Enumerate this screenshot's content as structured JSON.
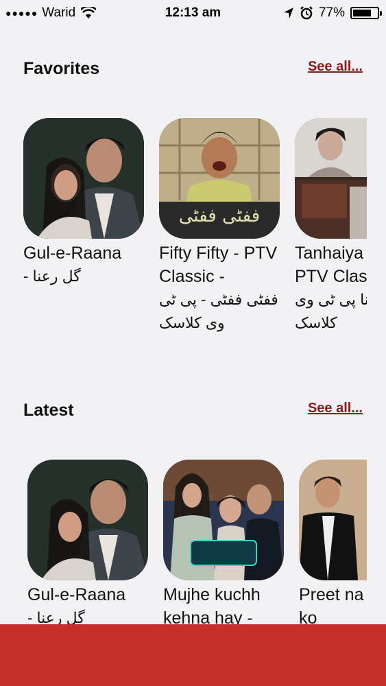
{
  "status_bar": {
    "carrier": "Warid",
    "time": "12:13 am",
    "battery": "77%",
    "battery_level": 0.77
  },
  "favorites": {
    "title": "Favorites",
    "see_all": "See all...",
    "items": [
      {
        "title_en": "Gul-e-Raana",
        "title_ur": "گل رعنا -"
      },
      {
        "title_en": "Fifty Fifty - PTV Classic -",
        "title_ur": "ففٹی ففٹی - پی ٹی وی کلاسک"
      },
      {
        "title_en": "Tanhaiya Old PTV Classic -",
        "title_ur": "پرانا پی ٹی وی کلاسک"
      }
    ],
    "thumb_text": "ففٹی ففٹی"
  },
  "latest": {
    "title": "Latest",
    "see_all": "See all...",
    "items": [
      {
        "title_en": "Gul-e-Raana",
        "title_ur": "گل رعنا -"
      },
      {
        "title_en": "Mujhe kuchh kehna hay -",
        "title_ur": ""
      },
      {
        "title_en": "Preet na kariyo ko",
        "title_ur": ""
      }
    ]
  },
  "colors": {
    "accent": "#8a1c1c",
    "bottom_bar": "#c8302e",
    "background": "#f2f2f4"
  }
}
